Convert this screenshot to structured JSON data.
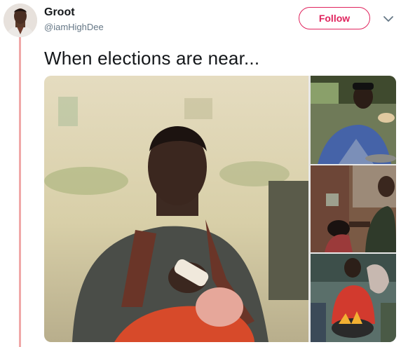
{
  "user": {
    "display_name": "Groot",
    "handle": "@iamHighDee"
  },
  "follow_button": {
    "label": "Follow"
  },
  "tweet": {
    "text": "When elections are near..."
  },
  "media": {
    "photo_count": 4
  },
  "icons": {
    "menu": "chevron-down-icon"
  },
  "colors": {
    "accent": "#e0245e",
    "thread_line": "#f0a8a8",
    "name": "#14171a",
    "handle": "#657786"
  }
}
